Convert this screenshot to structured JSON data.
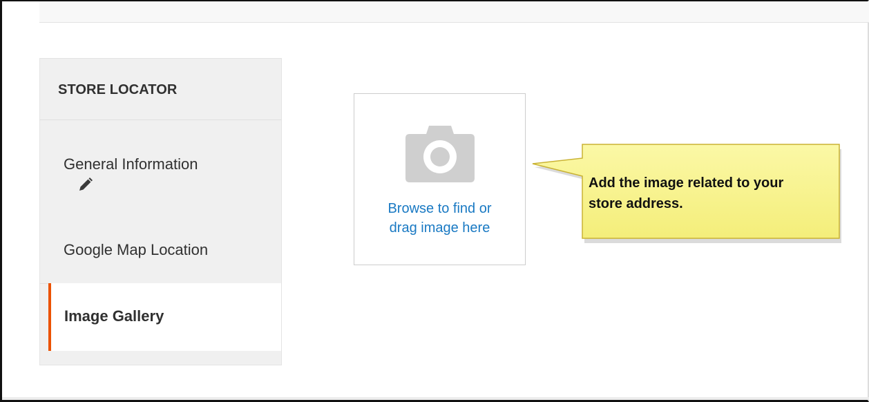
{
  "sidebar": {
    "title": "STORE LOCATOR",
    "items": [
      {
        "label": "General Information",
        "icon": "pencil-icon",
        "state": "edited"
      },
      {
        "label": "Google Map Location"
      },
      {
        "label": "Image Gallery",
        "state": "active"
      }
    ]
  },
  "uploader": {
    "icon": "camera-icon",
    "browse_line1": "Browse to find or",
    "browse_line2": "drag image here"
  },
  "callout": {
    "line1": "Add the image related to your",
    "line2": "store address."
  },
  "colors": {
    "accent": "#eb5202",
    "link": "#1979c3",
    "callout_bg": "#f7f290",
    "callout_border": "#c9b233"
  }
}
